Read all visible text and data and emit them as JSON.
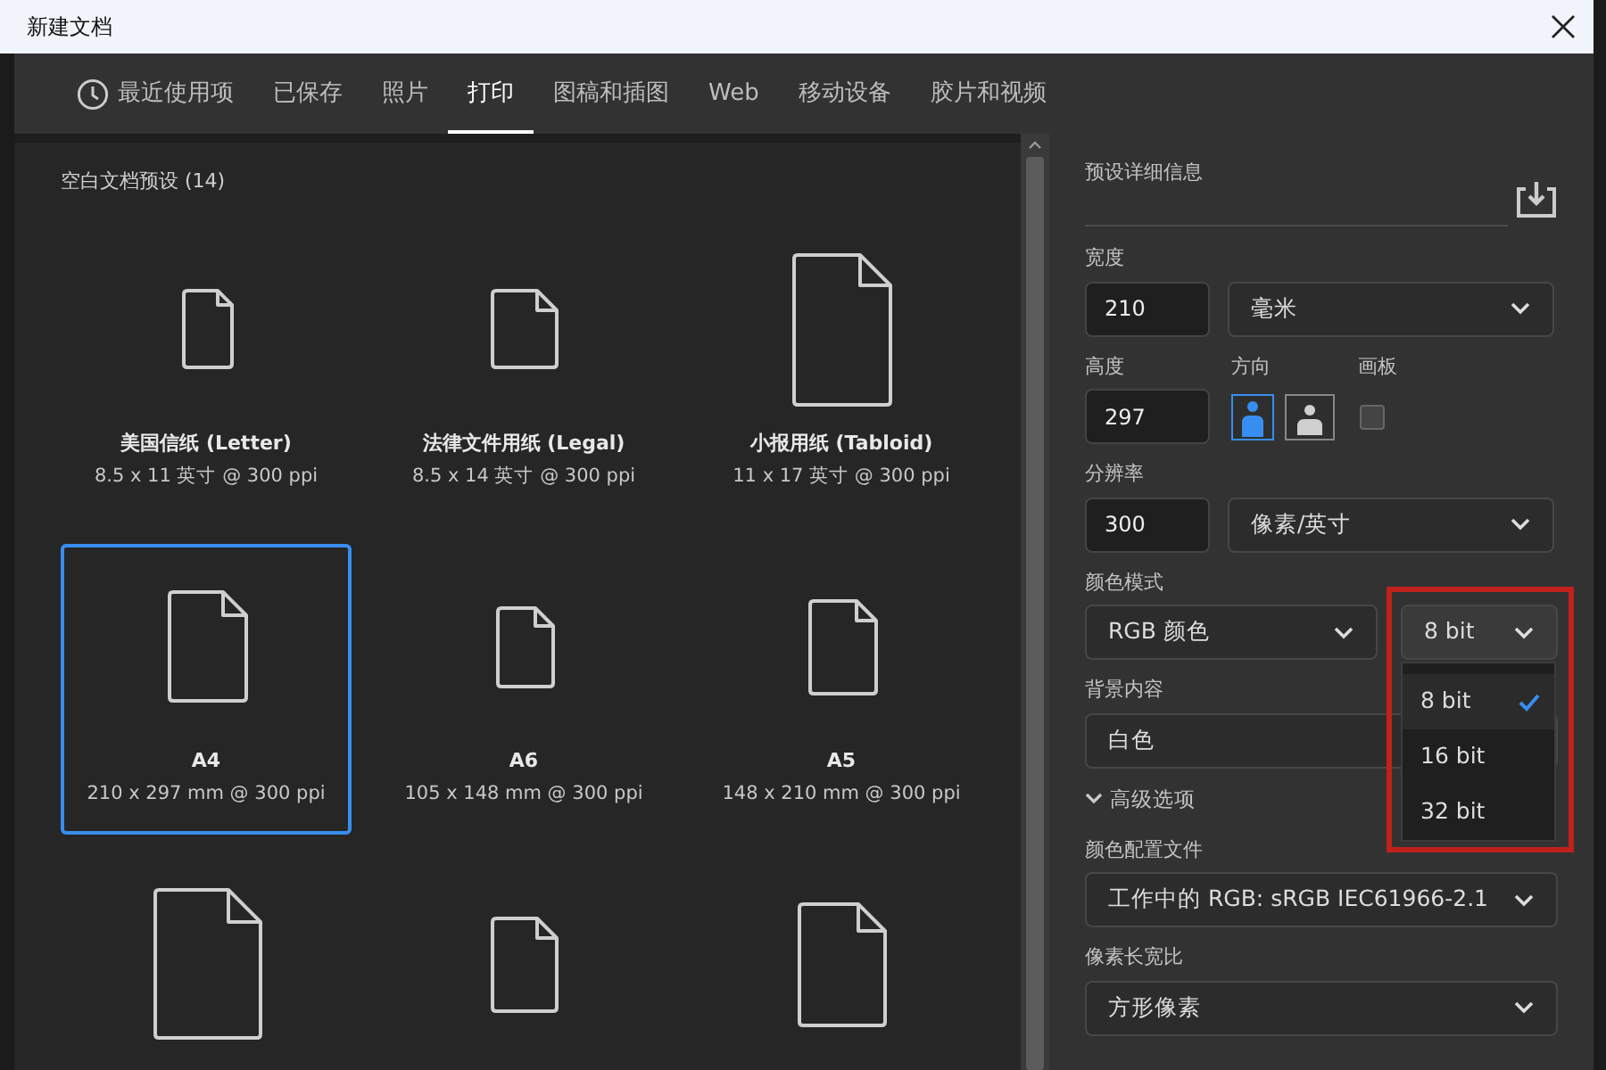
{
  "window": {
    "title": "新建文档"
  },
  "tabs": [
    {
      "label": "最近使用项",
      "kind": "recent",
      "selected": false
    },
    {
      "label": "已保存",
      "kind": "plain",
      "selected": false
    },
    {
      "label": "照片",
      "kind": "plain",
      "selected": false
    },
    {
      "label": "打印",
      "kind": "plain",
      "selected": true
    },
    {
      "label": "图稿和插图",
      "kind": "plain",
      "selected": false
    },
    {
      "label": "Web",
      "kind": "plain",
      "selected": false
    },
    {
      "label": "移动设备",
      "kind": "plain",
      "selected": false
    },
    {
      "label": "胶片和视频",
      "kind": "plain",
      "selected": false
    }
  ],
  "presets": {
    "title": "空白文档预设 (14)",
    "items": [
      {
        "name": "美国信纸 (Letter)",
        "size": "8.5 x 11 英寸 @ 300 ppi",
        "kind": "letter",
        "selected": false
      },
      {
        "name": "法律文件用纸 (Legal)",
        "size": "8.5 x 14 英寸 @ 300 ppi",
        "kind": "legal",
        "selected": false
      },
      {
        "name": "小报用纸 (Tabloid)",
        "size": "11 x 17 英寸 @ 300 ppi",
        "kind": "tabloid",
        "selected": false
      },
      {
        "name": "A4",
        "size": "210 x 297 mm @ 300 ppi",
        "kind": "a4",
        "selected": true
      },
      {
        "name": "A6",
        "size": "105 x 148 mm @ 300 ppi",
        "kind": "a6",
        "selected": false
      },
      {
        "name": "A5",
        "size": "148 x 210 mm @ 300 ppi",
        "kind": "a5",
        "selected": false
      },
      {
        "kind": "a3",
        "selected": false
      },
      {
        "kind": "b5",
        "selected": false
      },
      {
        "kind": "b4",
        "selected": false
      }
    ]
  },
  "details": {
    "title": "预设详细信息",
    "width": {
      "label": "宽度",
      "value": "210",
      "unit": "毫米"
    },
    "height": {
      "label": "高度",
      "value": "297"
    },
    "orientation": {
      "label": "方向",
      "options": [
        {
          "kind": "portrait",
          "selected": true
        },
        {
          "kind": "landscape",
          "selected": false
        }
      ]
    },
    "artboards": {
      "label": "画板",
      "checked": false
    },
    "resolution": {
      "label": "分辨率",
      "value": "300",
      "unit": "像素/英寸"
    },
    "color_mode": {
      "label": "颜色模式",
      "mode": "RGB 颜色",
      "depth": "8 bit",
      "highlighted": true,
      "depth_options": [
        {
          "label": "8 bit",
          "selected": true
        },
        {
          "label": "16 bit",
          "selected": false
        },
        {
          "label": "32 bit",
          "selected": false
        }
      ]
    },
    "background": {
      "label": "背景内容",
      "value": "白色"
    },
    "advanced": {
      "label": "高级选项",
      "expanded": true
    },
    "color_profile": {
      "label": "颜色配置文件",
      "value": "工作中的 RGB: sRGB IEC61966-2.1"
    },
    "pixel_aspect": {
      "label": "像素长宽比",
      "value": "方形像素"
    }
  }
}
